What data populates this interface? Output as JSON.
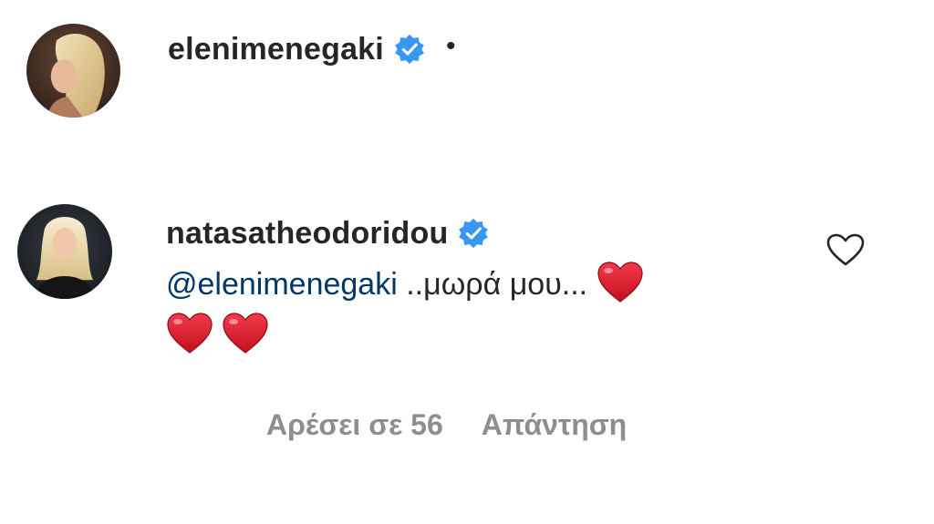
{
  "post": {
    "username": "elenimenegaki",
    "verified_icon": "verified-badge-icon",
    "separator": "•"
  },
  "comment": {
    "username": "natasatheodoridou",
    "verified_icon": "verified-badge-icon",
    "mention": "@elenimenegaki",
    "text": " ..μωρά μου...",
    "emoji": [
      "red-heart",
      "red-heart",
      "red-heart"
    ],
    "like_icon": "heart-outline-icon",
    "likes_label": "Αρέσει σε 56",
    "reply_label": "Απάντηση"
  },
  "colors": {
    "text": "#262626",
    "mention": "#00376b",
    "meta": "#8e8e8e",
    "verified": "#3897f0",
    "heart": "#e0192d"
  }
}
